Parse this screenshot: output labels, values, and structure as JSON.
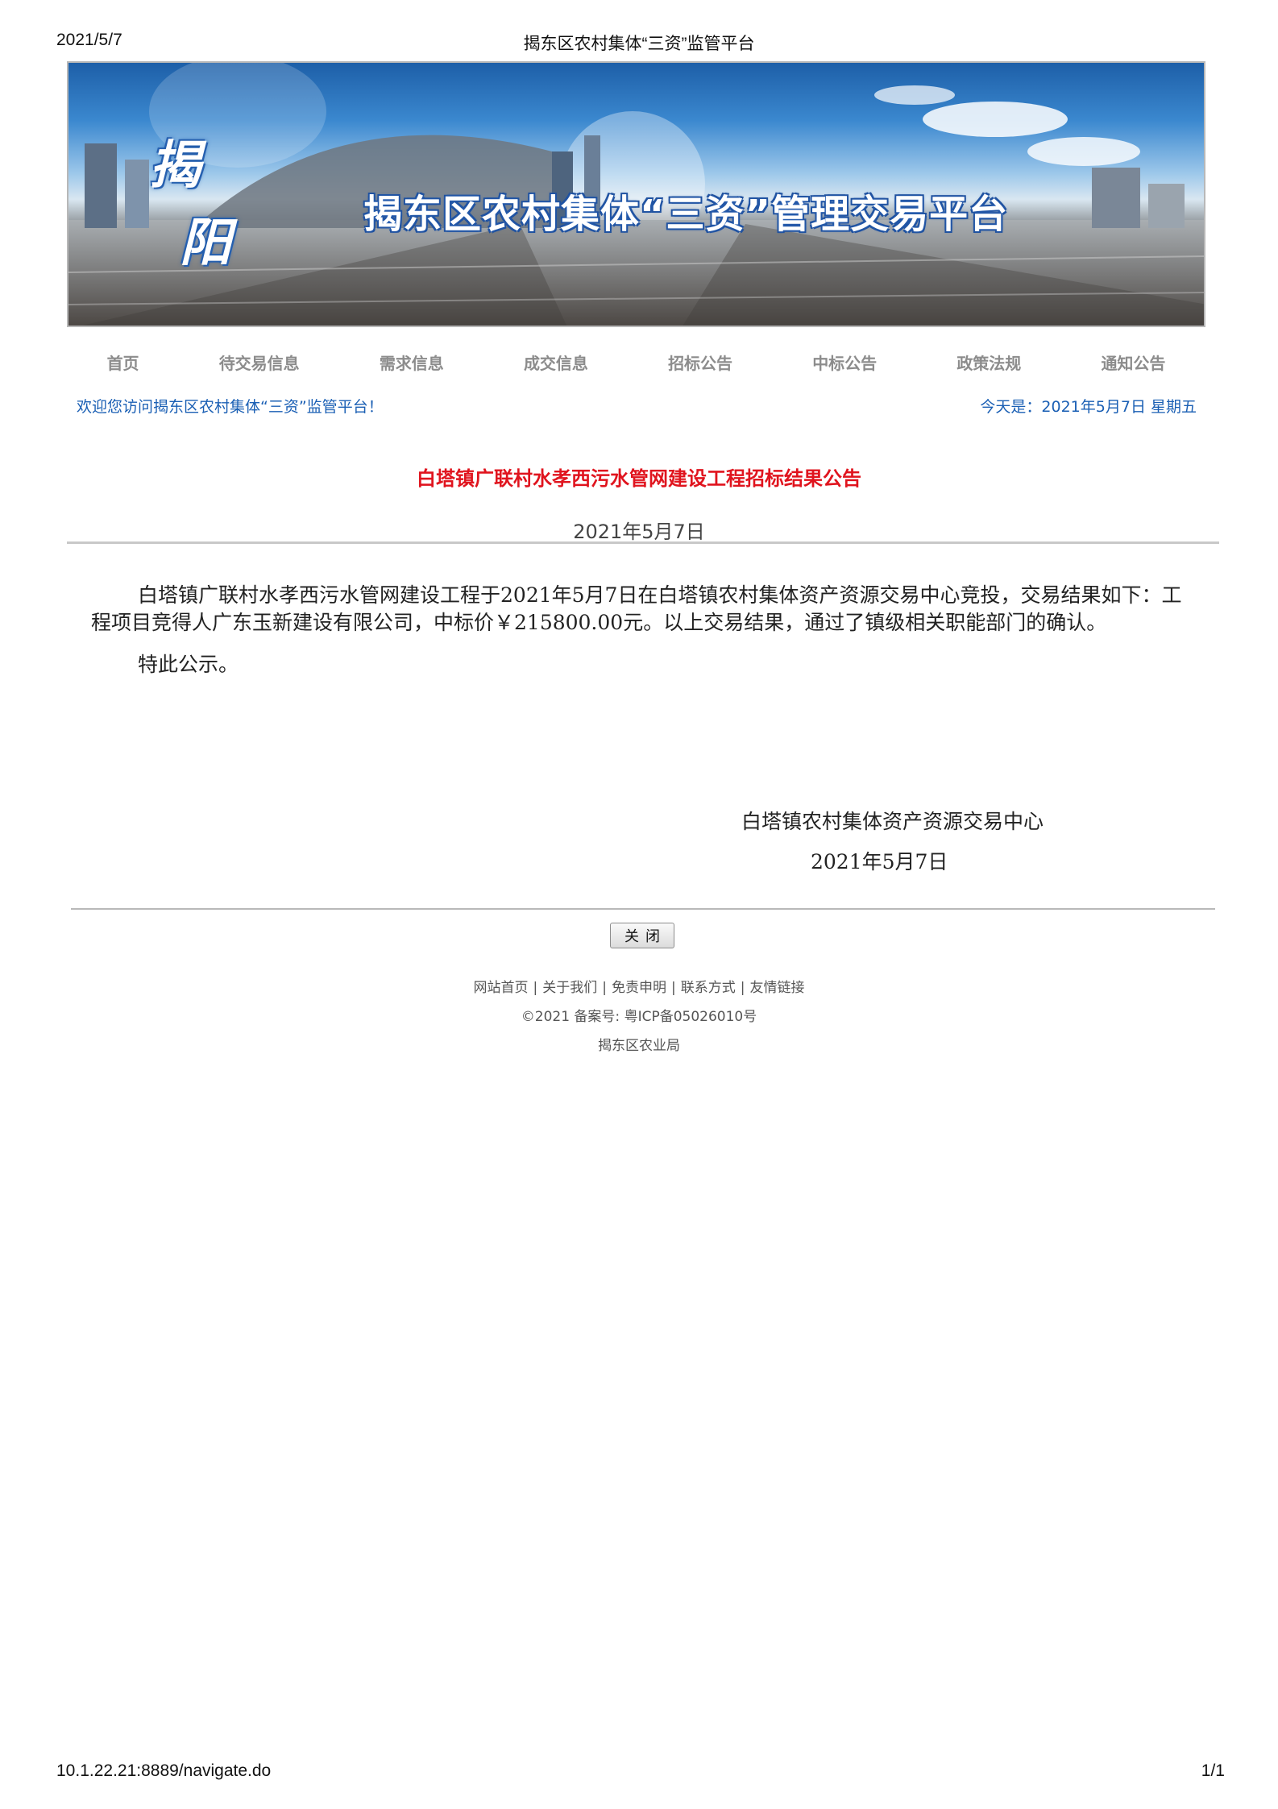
{
  "print_header": {
    "date": "2021/5/7",
    "title": "揭东区农村集体“三资”监管平台"
  },
  "banner": {
    "logo_char_1": "揭",
    "logo_char_2": "阳",
    "title": "揭东区农村集体“三资”管理交易平台"
  },
  "nav": {
    "items": [
      {
        "label": "首页"
      },
      {
        "label": "待交易信息"
      },
      {
        "label": "需求信息"
      },
      {
        "label": "成交信息"
      },
      {
        "label": "招标公告"
      },
      {
        "label": "中标公告"
      },
      {
        "label": "政策法规"
      },
      {
        "label": "通知公告"
      }
    ]
  },
  "welcome": {
    "left": "欢迎您访问揭东区农村集体“三资”监管平台！",
    "right": "今天是：2021年5月7日 星期五"
  },
  "article": {
    "title": "白塔镇广联村水孝西污水管网建设工程招标结果公告",
    "date": "2021年5月7日",
    "paragraph_1": "白塔镇广联村水孝西污水管网建设工程于2021年5月7日在白塔镇农村集体资产资源交易中心竞投，交易结果如下：工程项目竞得人广东玉新建设有限公司，中标价￥215800.00元。以上交易结果，通过了镇级相关职能部门的确认。",
    "paragraph_2": "特此公示。",
    "signature_org": "白塔镇农村集体资产资源交易中心",
    "signature_date": "2021年5月7日"
  },
  "close_button": {
    "label": "关闭"
  },
  "footer": {
    "links": [
      "网站首页",
      "关于我们",
      "免责申明",
      "联系方式",
      "友情链接"
    ],
    "separator": "|",
    "record": "©2021  备案号: 粤ICP备05026010号",
    "org": "揭东区农业局"
  },
  "print_footer": {
    "url": "10.1.22.21:8889/navigate.do",
    "page": "1/1"
  },
  "colors": {
    "title_red": "#e0141e",
    "link_blue": "#1a5fb4",
    "nav_gray": "#8c8c8c"
  }
}
